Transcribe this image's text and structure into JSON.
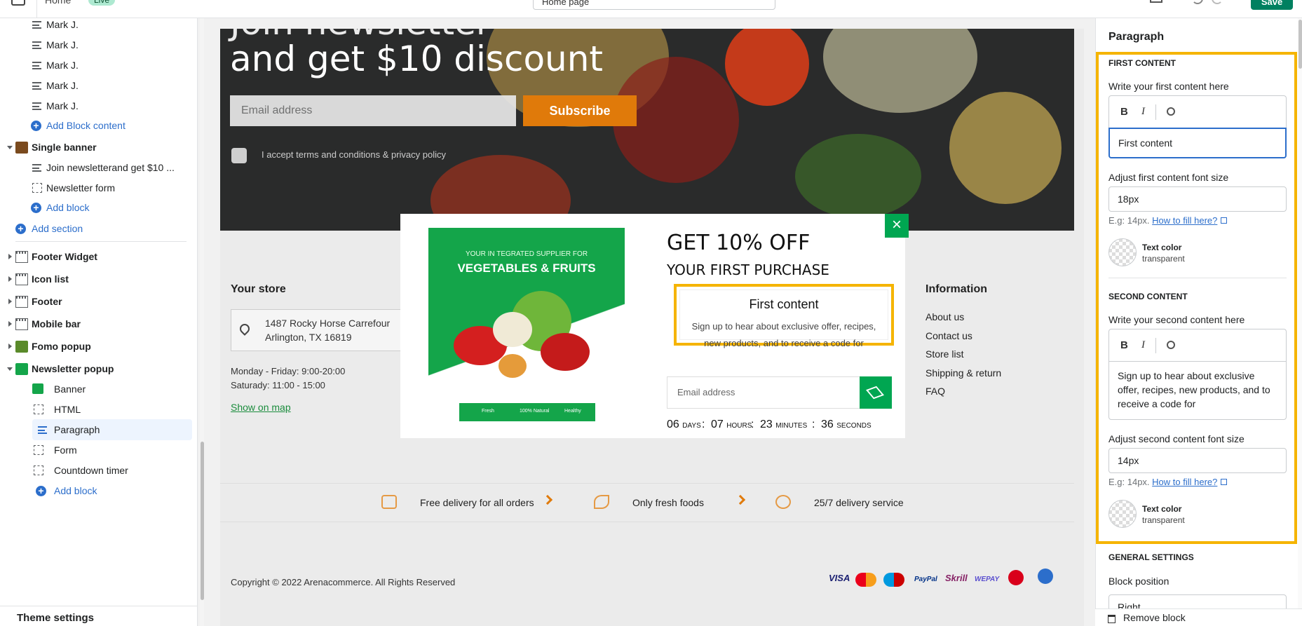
{
  "topbar": {
    "home_label": "Home",
    "live_badge": "Live",
    "page_select": "Home page",
    "save_label": "Save"
  },
  "sidebar": {
    "block_items": [
      "Mark J.",
      "Mark J.",
      "Mark J.",
      "Mark J.",
      "Mark J."
    ],
    "add_block_content": "Add Block content",
    "single_banner": "Single banner",
    "single_banner_children": [
      "Join newsletterand get $10 ...",
      "Newsletter form"
    ],
    "add_block": "Add block",
    "add_section": "Add section",
    "sections": [
      "Footer Widget",
      "Icon list",
      "Footer",
      "Mobile bar",
      "Fomo popup"
    ],
    "newsletter_popup": "Newsletter popup",
    "popup_children": [
      "Banner",
      "HTML",
      "Paragraph",
      "Form",
      "Countdown timer"
    ],
    "add_block_2": "Add block",
    "theme_settings": "Theme settings"
  },
  "canvas": {
    "banner": {
      "title_line1": "Join newsletter",
      "title_line2": "and get $10 discount",
      "email_placeholder": "Email address",
      "subscribe_label": "Subscribe",
      "terms": "I accept terms and conditions & privacy policy"
    },
    "footer": {
      "your_store": "Your store",
      "address_line1": "1487 Rocky Horse Carrefour",
      "address_line2": "Arlington, TX 16819",
      "hours1": "Monday - Friday: 9:00-20:00",
      "hours2": "Saturady: 11:00 - 15:00",
      "show_map": "Show on map",
      "information": "Information",
      "info_links": [
        "About us",
        "Contact us",
        "Store list",
        "Shipping & return",
        "FAQ"
      ]
    },
    "features": [
      "Free delivery for all orders",
      "Only fresh foods",
      "25/7 delivery service"
    ],
    "copyright": "Copyright © 2022 Arenacommerce. All Rights Reserved",
    "payments": [
      "VISA",
      "MasterCard",
      "Maestro",
      "PayPal",
      "Skrill",
      "WEPAY",
      "",
      ""
    ]
  },
  "modal": {
    "promo_line1": "YOUR IN TEGRATED SUPPLIER FOR",
    "promo_line2": "VEGETABLES & FRUITS",
    "promo_badges": [
      "Fresh",
      "100% Natural",
      "Healthy"
    ],
    "heading1": "GET 10% OFF",
    "heading2": "YOUR FIRST PURCHASE",
    "first_content": "First content",
    "second_content": "Sign up to hear about exclusive offer, recipes, new products, and to receive a code for",
    "email_placeholder": "Email address",
    "countdown": [
      {
        "value": "06",
        "unit": "days"
      },
      {
        "value": "07",
        "unit": "hours"
      },
      {
        "value": "23",
        "unit": "minutes"
      },
      {
        "value": "36",
        "unit": "seconds"
      }
    ]
  },
  "panel": {
    "title": "Paragraph",
    "first_section": "FIRST CONTENT",
    "first_label": "Write your first content here",
    "first_value": "First content",
    "first_size_label": "Adjust first content font size",
    "first_size_value": "18px",
    "hint_prefix": "E.g: 14px.",
    "hint_link": "How to fill here?",
    "text_color_label": "Text color",
    "text_color_value": "transparent",
    "second_section": "SECOND CONTENT",
    "second_label": "Write your second content here",
    "second_value": "Sign up to hear about exclusive offer, recipes, new products, and to receive a code for",
    "second_size_label": "Adjust second content font size",
    "second_size_value": "14px",
    "general_section": "GENERAL SETTINGS",
    "block_position_label": "Block position",
    "block_position_value": "Right",
    "remove_block": "Remove block"
  },
  "colors": {
    "accent": "#00a651",
    "highlight": "#f5b400",
    "link": "#2c6ecb",
    "orange": "#e07a0a"
  }
}
